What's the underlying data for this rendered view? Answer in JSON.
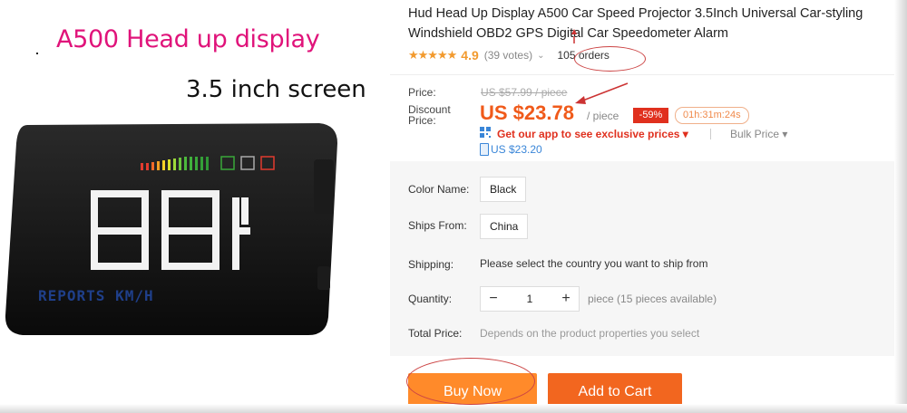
{
  "image": {
    "heading": "A500 Head up display",
    "subheading": "3.5 inch screen",
    "display_digits": "88:1",
    "display_text": "REPORTS KM/H"
  },
  "product": {
    "title_line1": "Hud Head Up Display A500 Car Speed Projector 3.5Inch Universal Car-styling",
    "title_line2": "Windshield OBD2 GPS Digital Car Speedometer Alarm",
    "rating": "4.9",
    "votes": "(39 votes)",
    "orders": "105 orders"
  },
  "price": {
    "price_label": "Price:",
    "old_price": "US $57.99 / piece",
    "discount_label": "Discount Price:",
    "current_price": "US $23.78",
    "per_piece": "/ piece",
    "discount_pct": "-59%",
    "countdown": "01h:31m:24s",
    "app_promo": "Get our app to see exclusive prices",
    "bulk_price": "Bulk Price",
    "app_price": "US $23.20"
  },
  "options": {
    "color_label": "Color Name:",
    "color_value": "Black",
    "ships_from_label": "Ships From:",
    "ships_from_value": "China",
    "shipping_label": "Shipping:",
    "shipping_text": "Please select the country you want to ship from",
    "quantity_label": "Quantity:",
    "quantity_value": "1",
    "quantity_note": "piece (15 pieces available)",
    "total_label": "Total Price:",
    "total_text": "Depends on the product properties you select"
  },
  "actions": {
    "buy_now": "Buy Now",
    "add_to_cart": "Add to Cart"
  },
  "colors": {
    "accent_orange": "#f05a1a",
    "buy_button": "#ff8a2a",
    "cart_button": "#f2661f",
    "heading_magenta": "#e0137a",
    "annotation_red": "#cc3333"
  }
}
